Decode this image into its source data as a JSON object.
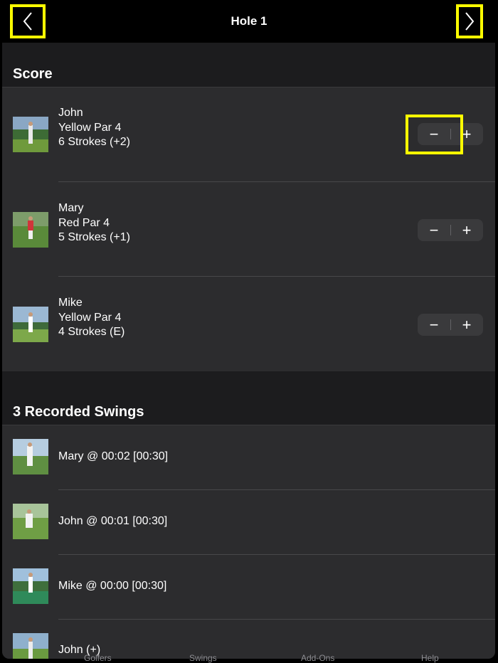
{
  "header": {
    "title": "Hole 1",
    "back_icon": "chevron-left-icon",
    "forward_icon": "chevron-right-icon",
    "highlight_color": "#ffff00"
  },
  "score_section": {
    "title": "Score",
    "rows": [
      {
        "name": "John",
        "tee": "Yellow Par 4",
        "strokes": "6 Strokes (+2)",
        "minus": "−",
        "plus": "+"
      },
      {
        "name": "Mary",
        "tee": "Red Par 4",
        "strokes": "5 Strokes (+1)",
        "minus": "−",
        "plus": "+"
      },
      {
        "name": "Mike",
        "tee": "Yellow Par 4",
        "strokes": "4 Strokes (E)",
        "minus": "−",
        "plus": "+"
      }
    ]
  },
  "swings_section": {
    "title": "3 Recorded Swings",
    "rows": [
      {
        "label": "Mary @ 00:02 [00:30]"
      },
      {
        "label": "John @ 00:01 [00:30]"
      },
      {
        "label": "Mike @ 00:00 [00:30]"
      },
      {
        "label": "John (+)"
      }
    ]
  },
  "tabbar": {
    "items": [
      "Golfers",
      "Swings",
      "Add-Ons",
      "Help"
    ]
  }
}
